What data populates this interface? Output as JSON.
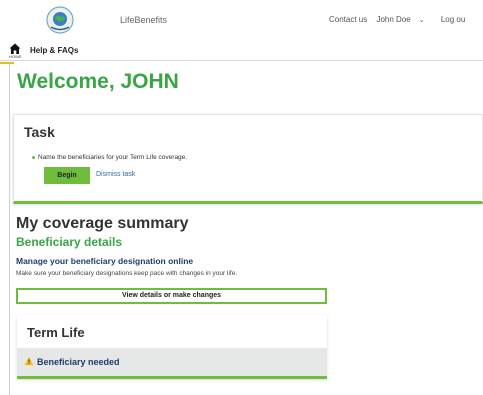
{
  "header": {
    "app_name": "LifeBenefits",
    "contact": "Contact us",
    "user": "John Doe",
    "logout": "Log ou"
  },
  "subnav": {
    "home_label": "HOME",
    "help": "Help & FAQs"
  },
  "welcome": "Welcome, JOHN",
  "task": {
    "title": "Task",
    "item": "Name the beneficiaries for your Term Life coverage.",
    "begin": "Begin",
    "dismiss": "Dismiss task"
  },
  "coverage": {
    "title": "My coverage summary",
    "beneficiary_title": "Beneficiary details",
    "manage_title": "Manage your beneficiary designation online",
    "manage_desc": "Make sure your beneficiary designations keep pace with changes in your life.",
    "view_button": "View details or make changes"
  },
  "term_life": {
    "title": "Term Life",
    "status": "Beneficiary needed"
  },
  "colors": {
    "brand_green": "#3aa547",
    "button_green": "#6ebd3d",
    "navy": "#1f3c6e",
    "link_blue": "#2e6ca4",
    "warning_yellow": "#f2c31a"
  }
}
